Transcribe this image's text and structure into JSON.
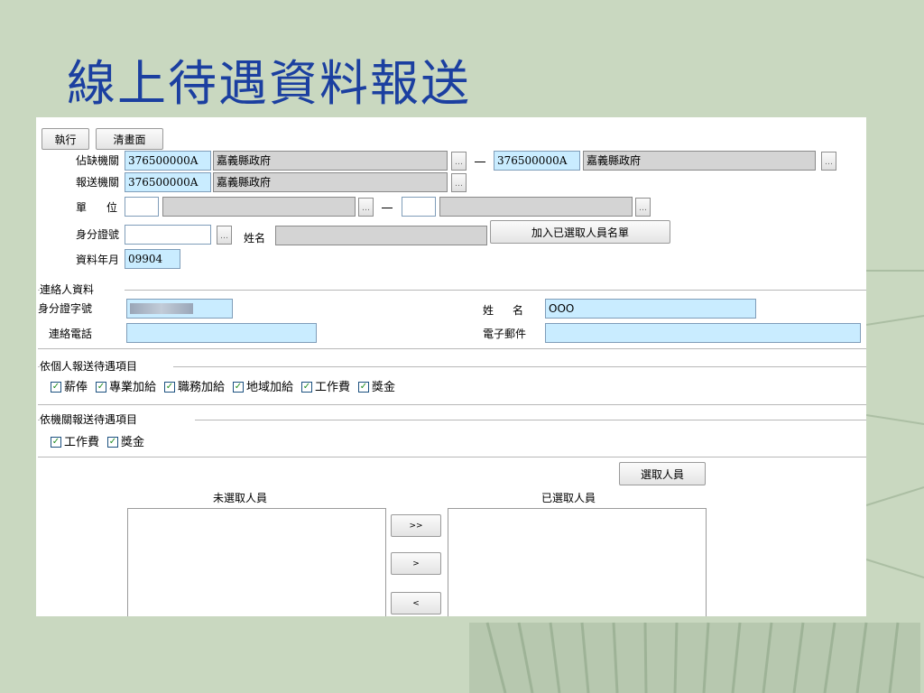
{
  "slide": {
    "title": "線上待遇資料報送"
  },
  "toolbar": {
    "execute_label": "執行",
    "clear_label": "清畫面"
  },
  "form": {
    "vacancy_org_label": "佔缺機關",
    "vacancy_org_code": "376500000A",
    "vacancy_org_name": "嘉義縣政府",
    "vacancy_org_code_to": "376500000A",
    "vacancy_org_name_to": "嘉義縣政府",
    "report_org_label": "報送機關",
    "report_org_code": "376500000A",
    "report_org_name": "嘉義縣政府",
    "unit_label_1": "單",
    "unit_label_2": "位",
    "id_label": "身分證號",
    "name_label": "姓名",
    "add_selected_label": "加入已選取人員名單",
    "data_month_label": "資料年月",
    "data_month_value": "09904"
  },
  "contact": {
    "legend": "連絡人資料",
    "id_label": "身分證字號",
    "name_label_1": "姓",
    "name_label_2": "名",
    "name_value": "OOO",
    "phone_label": "連絡電話",
    "email_label": "電子郵件"
  },
  "personal_items": {
    "legend": "依個人報送待遇項目",
    "items": [
      "薪俸",
      "專業加給",
      "職務加給",
      "地域加給",
      "工作費",
      "獎金"
    ]
  },
  "org_items": {
    "legend": "依機關報送待遇項目",
    "items": [
      "工作費",
      "獎金"
    ]
  },
  "selection": {
    "select_button": "選取人員",
    "unselected_label": "未選取人員",
    "selected_label": "已選取人員",
    "move_all_right": ">>",
    "move_right": ">",
    "move_left": "<"
  }
}
